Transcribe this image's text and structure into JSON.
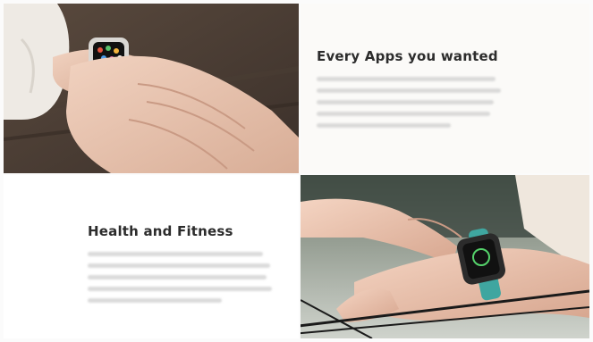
{
  "sections": [
    {
      "heading": "Every Apps you wanted"
    },
    {
      "heading": "Health and Fitness"
    }
  ],
  "icons": {
    "photo1": "watch-apps-photo",
    "photo2": "watch-fitness-photo"
  },
  "colors": {
    "heading": "#2c2c2c",
    "panel_bg": "#fbfaf8",
    "blurred_text": "#cfcfcf",
    "watch_band_teal": "#3fa6a0"
  }
}
